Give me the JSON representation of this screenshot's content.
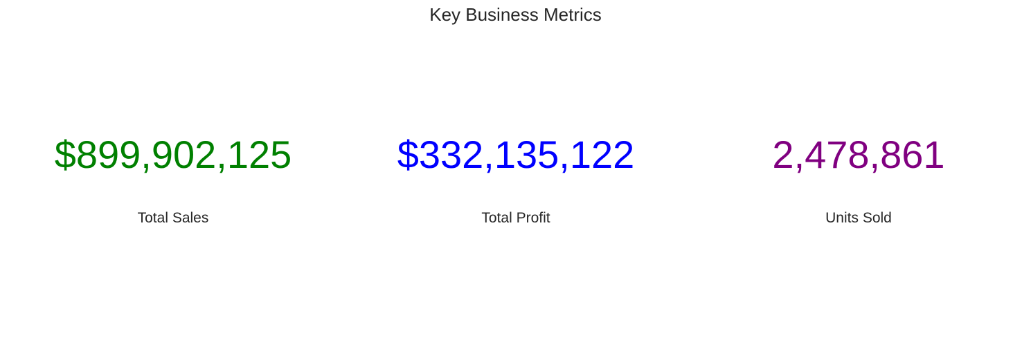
{
  "title": "Key Business Metrics",
  "chart_data": {
    "type": "table",
    "title": "Key Business Metrics",
    "metrics": [
      {
        "label": "Total Sales",
        "display": "$899,902,125",
        "value": 899902125,
        "color": "#008000"
      },
      {
        "label": "Total Profit",
        "display": "$332,135,122",
        "value": 332135122,
        "color": "#0000ff"
      },
      {
        "label": "Units Sold",
        "display": "2,478,861",
        "value": 2478861,
        "color": "#800080"
      }
    ]
  }
}
